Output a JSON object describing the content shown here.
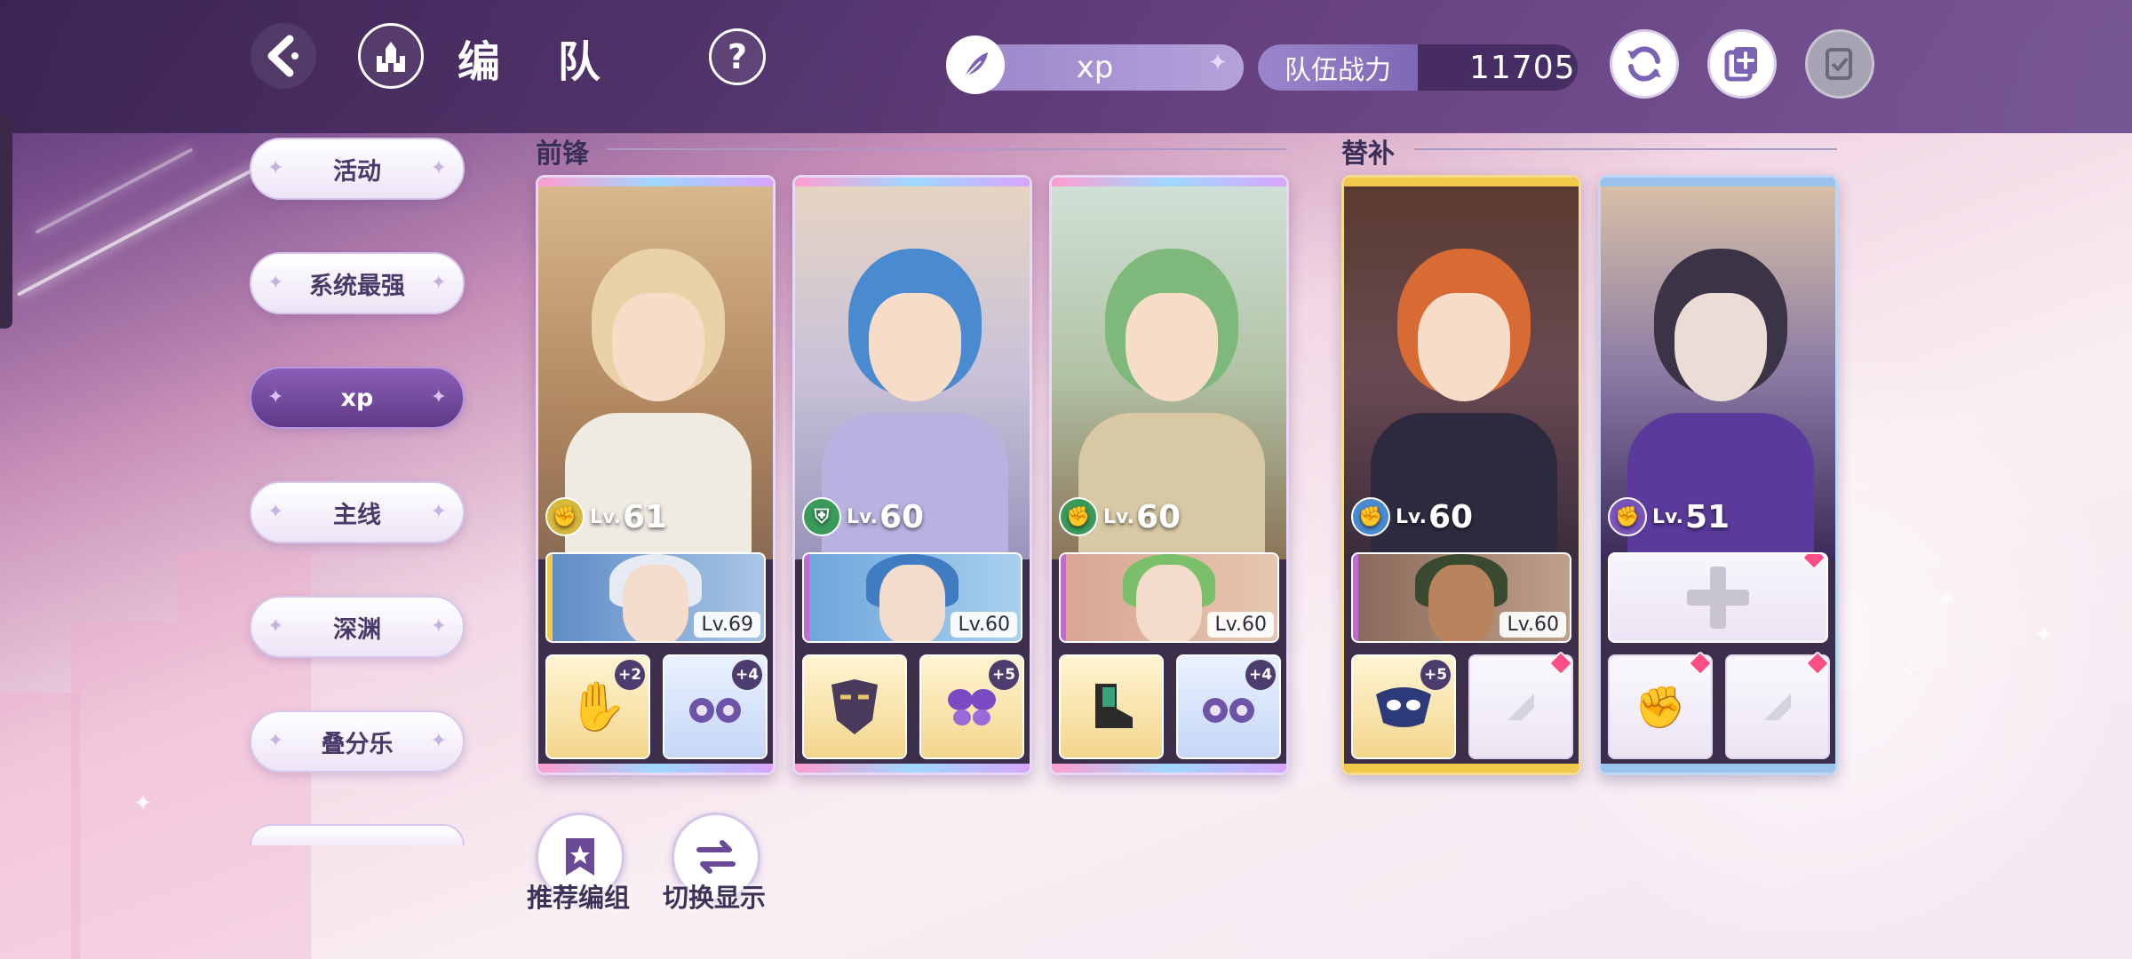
{
  "header": {
    "title": "编 队",
    "team_name": "xp",
    "power_label": "队伍战力",
    "power_value": "11705"
  },
  "sidebar": {
    "items": [
      {
        "label": "活动",
        "active": false
      },
      {
        "label": "系统最强",
        "active": false
      },
      {
        "label": "xp",
        "active": true
      },
      {
        "label": "主线",
        "active": false
      },
      {
        "label": "深渊",
        "active": false
      },
      {
        "label": "叠分乐",
        "active": false
      }
    ]
  },
  "sections": {
    "front_label": "前锋",
    "sub_label": "替补"
  },
  "level_prefix": "Lv.",
  "cards": [
    {
      "level": "61",
      "class_icon": "fist-icon",
      "support_level": "Lv.69",
      "equip1_plus": "+2",
      "equip2_plus": "+4"
    },
    {
      "level": "60",
      "class_icon": "shield-icon",
      "support_level": "Lv.60",
      "equip1_plus": "",
      "equip2_plus": "+5"
    },
    {
      "level": "60",
      "class_icon": "fist-icon",
      "support_level": "Lv.60",
      "equip1_plus": "",
      "equip2_plus": "+4"
    },
    {
      "level": "60",
      "class_icon": "fist-icon",
      "support_level": "Lv.60",
      "equip1_plus": "+5",
      "equip2_plus": ""
    },
    {
      "level": "51",
      "class_icon": "fist-icon",
      "support_level": "",
      "equip1_plus": "",
      "equip2_plus": ""
    }
  ],
  "bottom": {
    "recommend_label": "推荐编组",
    "switch_label": "切换显示"
  },
  "colors": {
    "accent": "#6a4a96",
    "gem": "#ff4d86",
    "gold_frame": "#f1c94b",
    "blue_frame": "#9cc3ee"
  }
}
